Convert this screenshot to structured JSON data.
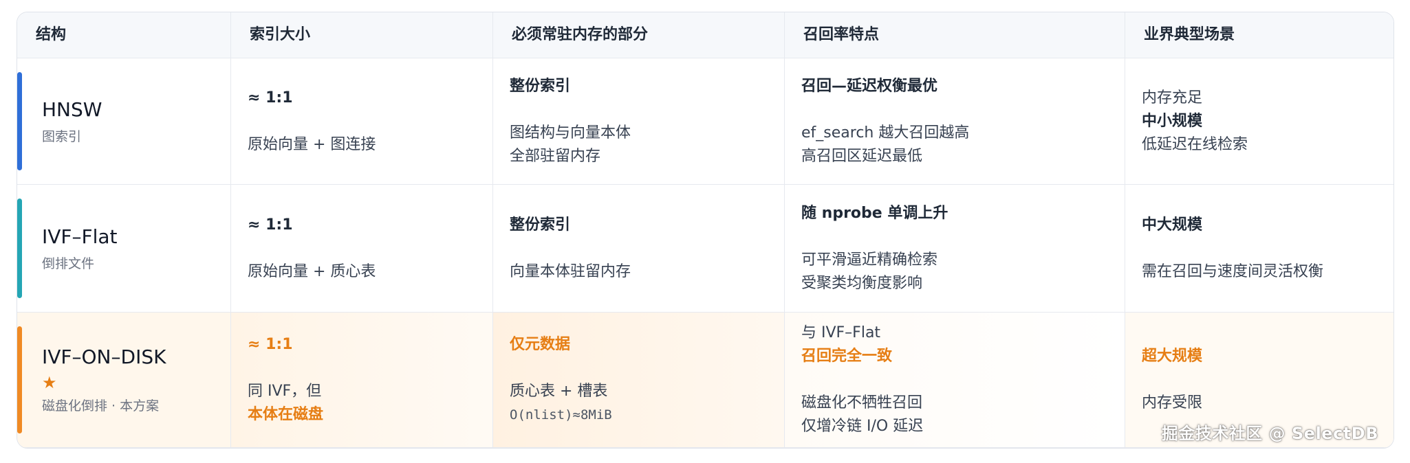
{
  "headers": [
    "结构",
    "索引大小",
    "必须常驻内存的部分",
    "召回率特点",
    "业界典型场景"
  ],
  "colors": {
    "hnsw_accent": "#2f6fd8",
    "ivfflat_accent": "#24a6b4",
    "ivfdisk_accent": "#f08a24",
    "highlight_text": "#e67e14"
  },
  "rows": [
    {
      "name": "HNSW",
      "subtitle": "图索引",
      "size_main": "≈ 1:1",
      "size_note": "原始向量 + 图连接",
      "memory_main": "整份索引",
      "memory_note_1": "图结构与向量本体",
      "memory_note_2": "全部驻留内存",
      "recall_main": "召回—延迟权衡最优",
      "recall_note_1": "ef_search 越大召回越高",
      "recall_note_2": "高召回区延迟最低",
      "scene_1": "内存充足",
      "scene_2": "中小规模",
      "scene_3": "低延迟在线检索"
    },
    {
      "name": "IVF–Flat",
      "subtitle": "倒排文件",
      "size_main": "≈ 1:1",
      "size_note": "原始向量 + 质心表",
      "memory_main": "整份索引",
      "memory_note_1": "向量本体驻留内存",
      "recall_main": "随 nprobe 单调上升",
      "recall_note_1": "可平滑逼近精确检索",
      "recall_note_2": "受聚类均衡度影响",
      "scene_1": "中大规模",
      "scene_2": "需在召回与速度间灵活权衡"
    },
    {
      "name": "IVF–ON–DISK",
      "star": "★",
      "subtitle": "磁盘化倒排 · 本方案",
      "size_main": "≈ 1:1",
      "size_note_1": "同 IVF，但",
      "size_note_2": "本体在磁盘",
      "memory_main": "仅元数据",
      "memory_note_1": "质心表 + 槽表",
      "memory_note_2": "O(nlist)≈8MiB",
      "recall_pre": "与 IVF–Flat",
      "recall_main": "召回完全一致",
      "recall_note_1": "磁盘化不牺牲召回",
      "recall_note_2": "仅增冷链 I/O 延迟",
      "scene_1": "超大规模",
      "scene_2": "内存受限"
    }
  ],
  "watermark": "掘金技术社区 @ SelectDB"
}
